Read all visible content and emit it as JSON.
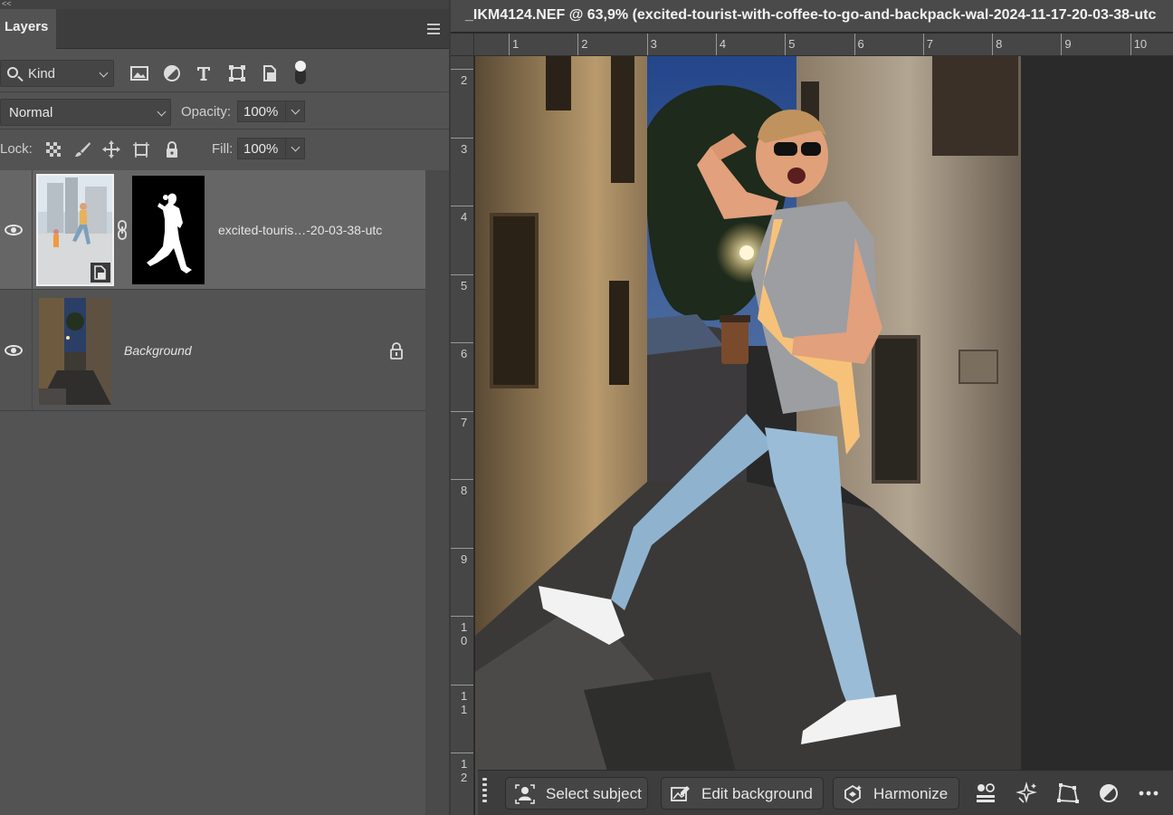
{
  "panel": {
    "collapse_glyph": "<<",
    "tab_label": "Layers",
    "filter": {
      "kind_label": "Kind"
    },
    "blend_mode": "Normal",
    "opacity_label": "Opacity:",
    "opacity_value": "100%",
    "lock_label": "Lock:",
    "fill_label": "Fill:",
    "fill_value": "100%"
  },
  "layers": [
    {
      "name": "excited-touris…-20-03-38-utc",
      "visible": true,
      "selected": true,
      "has_mask": true,
      "smart_object": true
    },
    {
      "name": "Background",
      "visible": true,
      "selected": false,
      "locked": true
    }
  ],
  "document": {
    "tab_title": "_IKM4124.NEF @ 63,9% (excited-tourist-with-coffee-to-go-and-backpack-wal-2024-11-17-20-03-38-utc",
    "ruler_h": [
      "1",
      "2",
      "3",
      "4",
      "5",
      "6",
      "7",
      "8",
      "9",
      "10"
    ],
    "ruler_v": [
      "2",
      "3",
      "4",
      "5",
      "6",
      "7",
      "8",
      "9",
      "1\n0",
      "1\n1",
      "1\n2"
    ]
  },
  "taskbar": {
    "select_subject": "Select subject",
    "edit_background": "Edit background",
    "harmonize": "Harmonize"
  },
  "icons": [
    "search-icon",
    "image-filter-icon",
    "adjustment-filter-icon",
    "type-filter-icon",
    "shape-filter-icon",
    "smartobject-filter-icon",
    "eye-icon",
    "lock-icon",
    "link-icon",
    "more-icon"
  ]
}
